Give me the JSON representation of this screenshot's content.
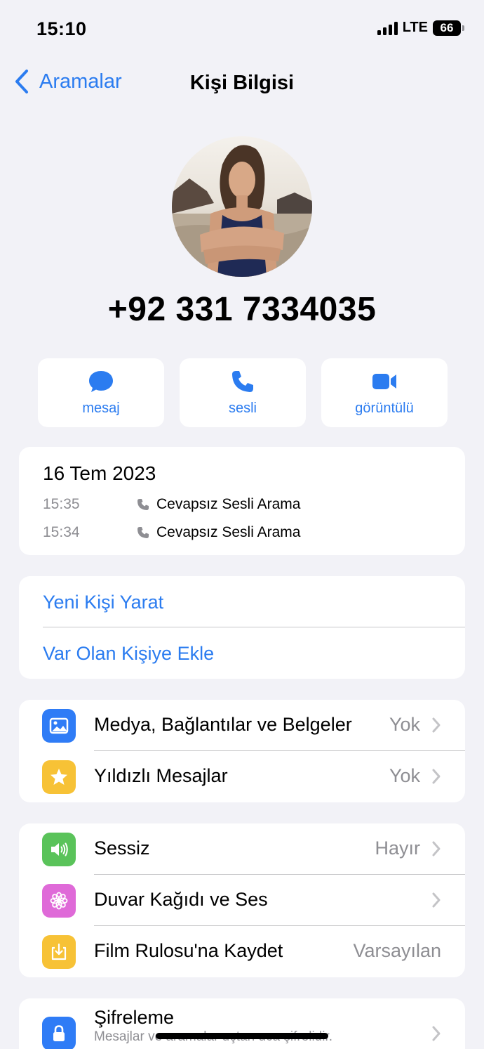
{
  "status_bar": {
    "time": "15:10",
    "network": "LTE",
    "battery": "66"
  },
  "nav": {
    "back_label": "Aramalar",
    "title": "Kişi Bilgisi"
  },
  "contact": {
    "phone": "+92 331 7334035"
  },
  "actions": [
    {
      "label": "mesaj",
      "icon": "message-bubble-icon"
    },
    {
      "label": "sesli",
      "icon": "phone-icon"
    },
    {
      "label": "görüntülü",
      "icon": "video-camera-icon"
    }
  ],
  "call_history": {
    "date": "16 Tem 2023",
    "calls": [
      {
        "time": "15:35",
        "type": "Cevapsız Sesli Arama"
      },
      {
        "time": "15:34",
        "type": "Cevapsız Sesli Arama"
      }
    ]
  },
  "contact_actions": {
    "create": "Yeni Kişi Yarat",
    "add_existing": "Var Olan Kişiye Ekle"
  },
  "media_section": [
    {
      "label": "Medya, Bağlantılar ve Belgeler",
      "value": "Yok",
      "icon": "photo-icon",
      "color": "#2f7cf6"
    },
    {
      "label": "Yıldızlı Mesajlar",
      "value": "Yok",
      "icon": "star-icon",
      "color": "#f7c236"
    }
  ],
  "settings_section": [
    {
      "label": "Sessiz",
      "value": "Hayır",
      "icon": "speaker-icon",
      "color": "#5ac35a"
    },
    {
      "label": "Duvar Kağıdı ve Ses",
      "value": "",
      "icon": "flower-icon",
      "color": "#df6ad8"
    },
    {
      "label": "Film Rulosu'na Kaydet",
      "value": "Varsayılan",
      "icon": "save-download-icon",
      "color": "#f7c236"
    }
  ],
  "encryption": {
    "title": "Şifreleme",
    "subtitle": "Mesajlar ve aramalar uçtan uca şifrelidir.",
    "icon": "lock-icon",
    "color": "#2f7cf6"
  },
  "colors": {
    "accent": "#2b7cf0",
    "background": "#f2f2f7",
    "secondary_text": "#8e8e93"
  }
}
